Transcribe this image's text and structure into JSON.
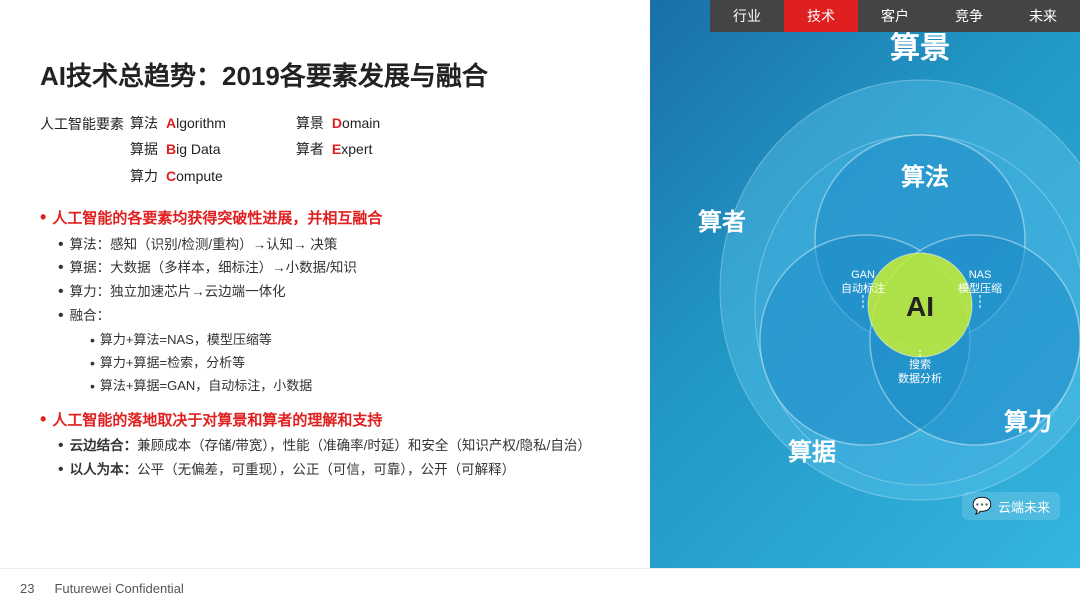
{
  "nav": {
    "items": [
      {
        "label": "行业",
        "active": false
      },
      {
        "label": "技术",
        "active": true
      },
      {
        "label": "客户",
        "active": false
      },
      {
        "label": "竞争",
        "active": false
      },
      {
        "label": "未来",
        "active": false
      }
    ]
  },
  "title": "AI技术总趋势：2019各要素发展与融合",
  "elements": {
    "label": "人工智能要素",
    "left_col": [
      {
        "zh": "算法",
        "en_prefix": "A",
        "en_rest": "lgorithm"
      },
      {
        "zh": "算据",
        "en_prefix": "B",
        "en_rest": "ig Data"
      },
      {
        "zh": "算力",
        "en_prefix": "C",
        "en_rest": "ompute"
      }
    ],
    "right_col": [
      {
        "zh": "算景",
        "en_prefix": "D",
        "en_rest": "omain"
      },
      {
        "zh": "算者",
        "en_prefix": "E",
        "en_rest": "xpert"
      }
    ]
  },
  "section1": {
    "title": "人工智能的各要素均获得突破性进展，并相互融合",
    "items": [
      "算法：感知（识别/检测/重构）→认知→ 决策",
      "算据：大数据（多样本，细标注）→小数据/知识",
      "算力：独立加速芯片→云边端一体化",
      "融合："
    ],
    "sub_items": [
      "算力+算法=NAS，模型压缩等",
      "算力+算据=检索，分析等",
      "算法+算据=GAN，自动标注，小数据"
    ]
  },
  "section2": {
    "title": "人工智能的落地取决于对算景和算者的理解和支持",
    "items": [
      {
        "label": "云边结合：",
        "text": "兼顾成本（存储/带宽），性能（准确率/时延）和安全（知识产权/隐私/自治）"
      },
      {
        "label": "以人为本：",
        "text": "公平（无偏差，可重现），公正（可信，可靠），公开（可解释）"
      }
    ]
  },
  "diagram": {
    "outer_label": "算景",
    "mid_labels": [
      "算者",
      "算法",
      "算据",
      "算力"
    ],
    "inner_labels": [
      "GAN\n自动标注",
      "NAS\n模型压缩",
      "搜索\n数据分析"
    ],
    "center_label": "AI"
  },
  "footer": {
    "page": "23",
    "confidential": "Futurewei Confidential"
  },
  "wechat": {
    "label": "云端未来"
  }
}
